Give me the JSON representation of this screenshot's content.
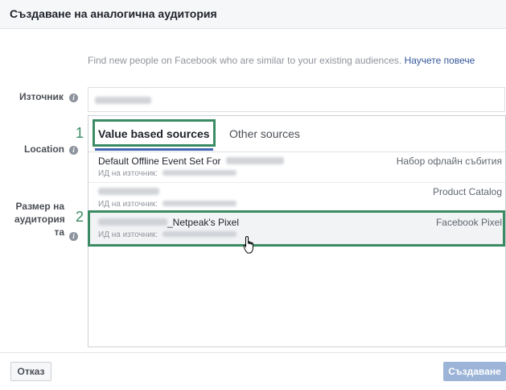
{
  "dialog": {
    "title": "Създаване на аналогична аудитория"
  },
  "description": {
    "text": "Find new people on Facebook who are similar to your existing audiences.",
    "link": "Научете повече"
  },
  "labels": {
    "source": "Източник",
    "location": "Location",
    "size_line1": "Размер на",
    "size_line2": "аудитория",
    "size_line3": "та"
  },
  "tabs": [
    {
      "label": "Value based sources",
      "active": true
    },
    {
      "label": "Other sources",
      "active": false
    }
  ],
  "sources": [
    {
      "name": "Default Offline Event Set For",
      "id_label": "ИД на източник:",
      "type": "Набор офлайн събития"
    },
    {
      "name": "",
      "id_label": "ИД на източник:",
      "type": "Product Catalog"
    },
    {
      "name": "_Netpeak's Pixel",
      "id_label": "ИД на източник:",
      "type": "Facebook Pixel"
    }
  ],
  "annotations": {
    "one": "1",
    "two": "2"
  },
  "footer": {
    "cancel": "Отказ",
    "create": "Създаване"
  },
  "colors": {
    "accent": "#4267b2",
    "highlight": "#3b8c64",
    "link": "#365899"
  }
}
